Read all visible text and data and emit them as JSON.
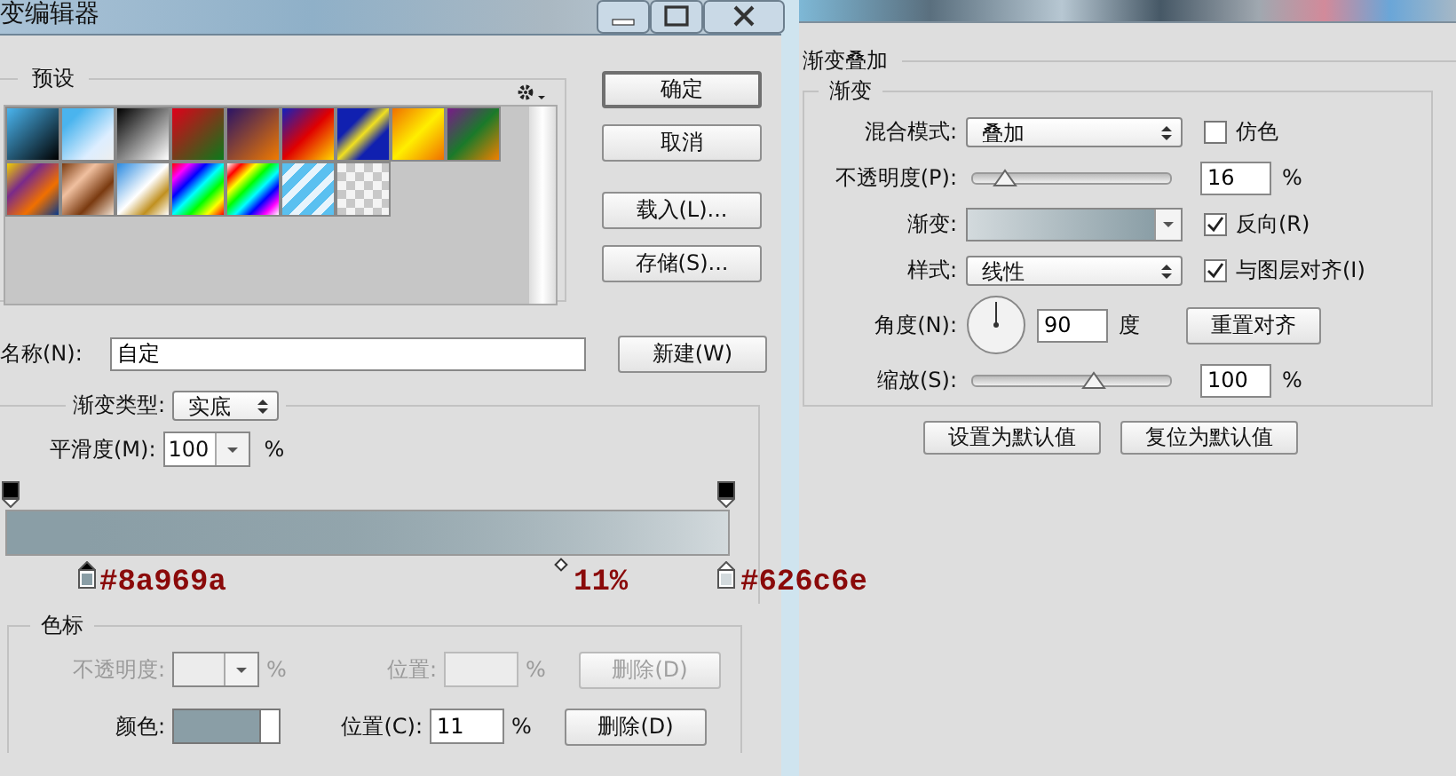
{
  "gradient_editor": {
    "title": "变编辑器",
    "presets": {
      "label": "预设"
    },
    "buttons": [
      "确定",
      "取消",
      "载入(L)...",
      "存储(S)..."
    ],
    "name": {
      "label": "名称(N):",
      "value": "自定"
    },
    "new_button": "新建(W)",
    "gradient_type": {
      "label": "渐变类型:",
      "value": "实底"
    },
    "smoothness": {
      "label": "平滑度(M):",
      "value": "100",
      "unit": "%"
    },
    "color_stops": [
      {
        "color": "#8a9ea6",
        "selected": true
      },
      {
        "color": "#d3dadd",
        "selected": false
      }
    ],
    "annotations": [
      "#8a969a",
      "11%",
      "#626c6e"
    ],
    "stops_group": {
      "label": "色标",
      "rows": [
        {
          "kind": "opacity",
          "label": "不透明度:",
          "unit": "%",
          "position_label": "位置:",
          "position_unit": "%",
          "delete": "删除(D)",
          "disabled": true
        },
        {
          "kind": "color",
          "label": "颜色:",
          "position_label": "位置(C):",
          "position_value": "11",
          "position_unit": "%",
          "delete": "删除(D)",
          "disabled": false
        }
      ]
    }
  },
  "layer_style": {
    "title": "渐变叠加",
    "group": "渐变",
    "rows": [
      {
        "kind": "select",
        "label": "混合模式:",
        "value": "叠加",
        "checkbox": {
          "label": "仿色",
          "checked": false
        }
      },
      {
        "kind": "slider",
        "label": "不透明度(P):",
        "level": 0.16,
        "value": "16",
        "unit": "%"
      },
      {
        "kind": "gradient",
        "label": "渐变:",
        "checkbox": {
          "label": "反向(R)",
          "checked": true
        }
      },
      {
        "kind": "select",
        "label": "样式:",
        "value": "线性",
        "checkbox": {
          "label": "与图层对齐(I)",
          "checked": true
        }
      },
      {
        "kind": "angle",
        "label": "角度(N):",
        "value": "90",
        "unit": "度",
        "button": "重置对齐"
      },
      {
        "kind": "slider",
        "label": "缩放(S):",
        "level": 0.61,
        "value": "100",
        "unit": "%"
      }
    ],
    "buttons": [
      "设置为默认值",
      "复位为默认值"
    ]
  }
}
